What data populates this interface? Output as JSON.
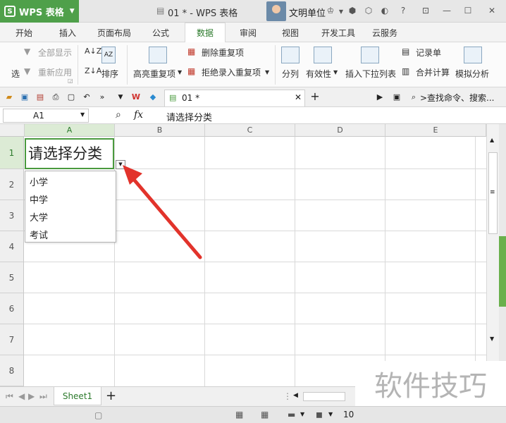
{
  "app": {
    "name": "WPS 表格",
    "title": "01 * - WPS 表格",
    "user": "文明单位"
  },
  "tabs": [
    "开始",
    "插入",
    "页面布局",
    "公式",
    "数据",
    "审阅",
    "视图",
    "开发工具",
    "云服务"
  ],
  "ribbon": {
    "left_partial": "选",
    "show_all": "全部显示",
    "reapply": "重新应用",
    "sort": "排序",
    "highlight_dup": "高亮重复项",
    "remove_dup": "删除重复项",
    "reject_dup": "拒绝录入重复项",
    "split_col": "分列",
    "validity": "有效性",
    "insert_dropdown": "插入下拉列表",
    "record_form": "记录单",
    "merge_calc": "合并计算",
    "simulate": "模拟分析"
  },
  "quickbar": {
    "doc_tab": "01 *",
    "search": ">查找命令、搜索..."
  },
  "formula": {
    "cell_ref": "A1",
    "fx": "fx",
    "content": "请选择分类"
  },
  "grid": {
    "columns": [
      "A",
      "B",
      "C",
      "D",
      "E"
    ],
    "rows": [
      "1",
      "2",
      "3",
      "4",
      "5",
      "6",
      "7",
      "8"
    ],
    "a1_value": "请选择分类"
  },
  "dropdown": {
    "options": [
      "小学",
      "中学",
      "大学",
      "考试"
    ]
  },
  "sheet": {
    "tab": "Sheet1",
    "add": "+",
    "zoom": "10"
  },
  "watermark": "软件技巧",
  "colors": {
    "brand_green": "#4fa04a",
    "selection_green": "#4a9a3e",
    "arrow_red": "#e2332b"
  }
}
